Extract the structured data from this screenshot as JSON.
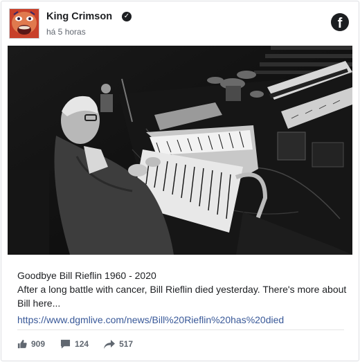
{
  "post": {
    "page_name": "King Crimson",
    "verified_icon": "verified-check-icon",
    "timestamp": "há 5 horas",
    "text_line1": "Goodbye Bill Rieflin 1960 - 2020",
    "text_line2": "After a long battle with cancer, Bill Rieflin died yesterday. There's more about Bill here...",
    "link": "https://www.dgmlive.com/news/Bill%20Rieflin%20has%20died"
  },
  "actions": {
    "likes": "909",
    "comments": "124",
    "shares": "517"
  },
  "icons": {
    "brand": "facebook-icon",
    "like": "thumbs-up-icon",
    "comment": "comment-bubble-icon",
    "share": "share-arrow-icon"
  },
  "colors": {
    "link": "#385898",
    "secondary_text": "#616770",
    "avatar_red": "#c23a26"
  }
}
